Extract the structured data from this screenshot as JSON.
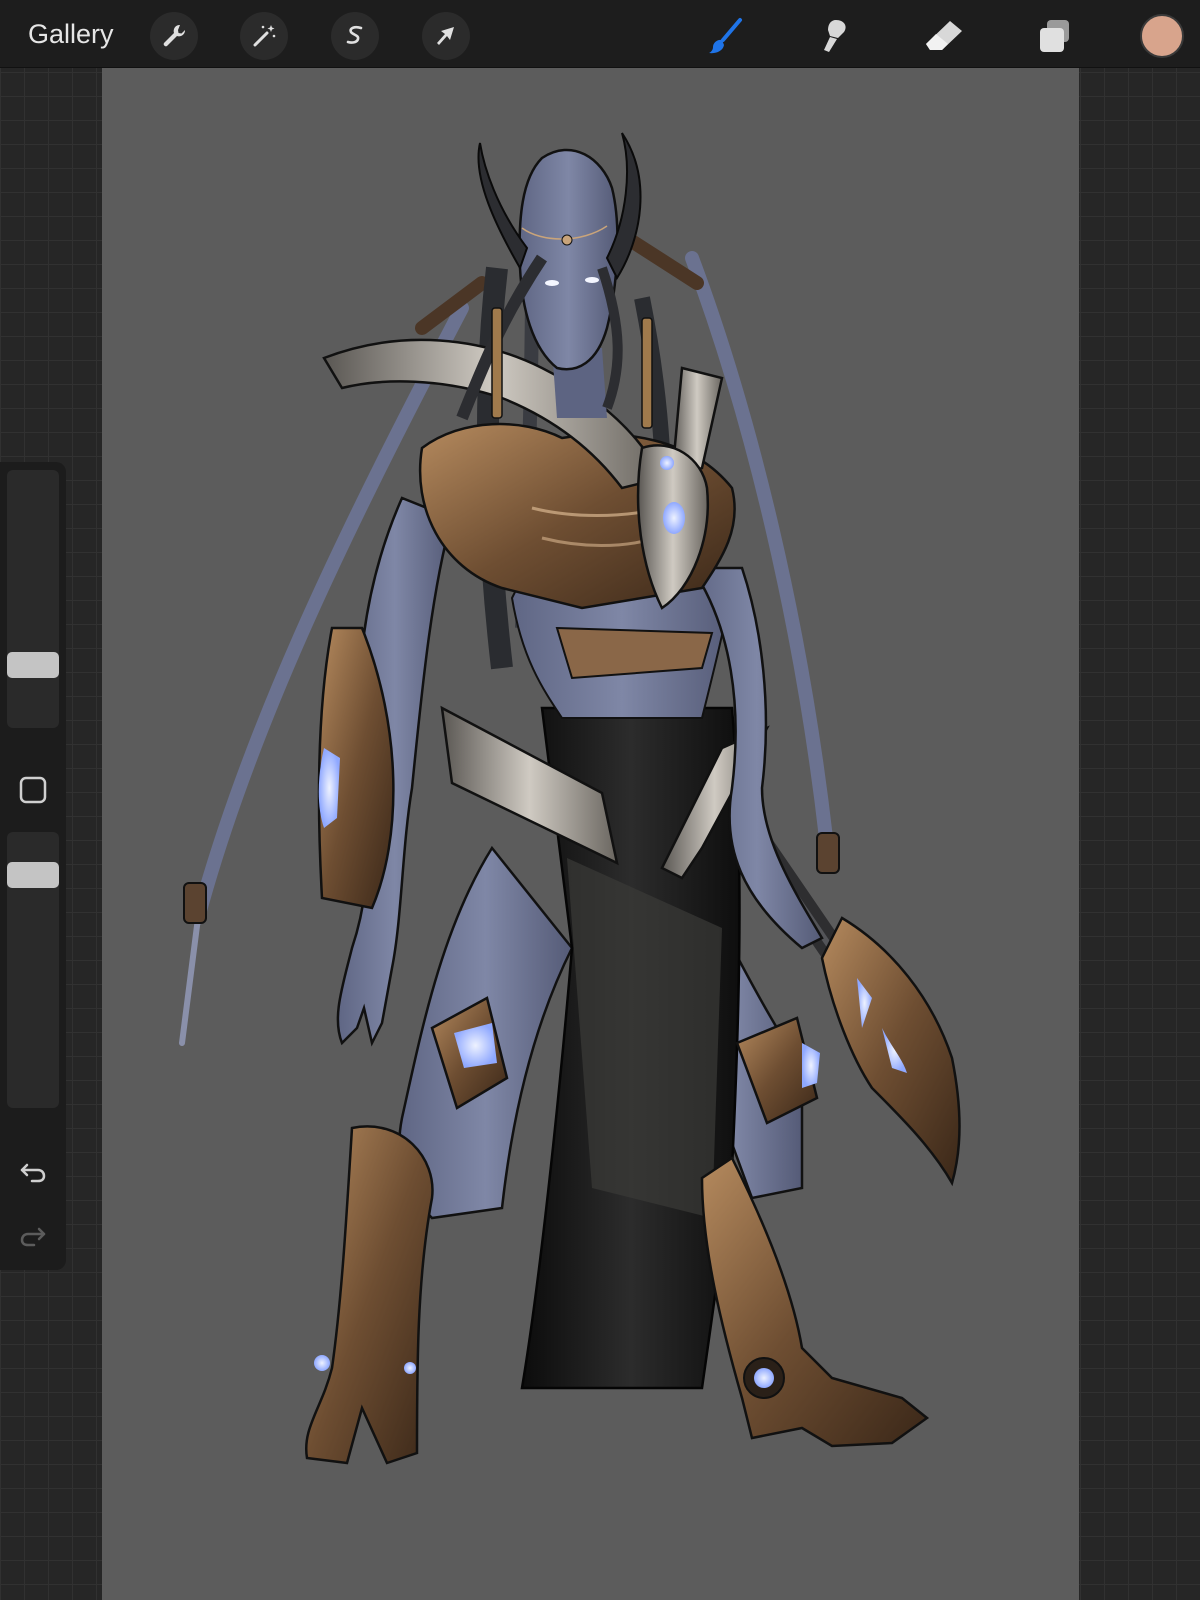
{
  "toolbar": {
    "gallery_label": "Gallery",
    "left_tools": [
      "wrench-icon",
      "magic-wand-icon",
      "selection-icon",
      "transform-arrow-icon"
    ],
    "right_tools": [
      "brush-icon",
      "smudge-icon",
      "eraser-icon",
      "layers-icon"
    ],
    "active_tool": "brush",
    "active_color": "#d8a48c",
    "accent_color": "#1f74e8"
  },
  "sidebar": {
    "brush_size": 0.25,
    "brush_opacity": 0.85
  },
  "colors": {
    "canvas": "#5c5c5c",
    "skin": "#717896",
    "armor_bronze": "#7a5a3c",
    "armor_steel": "#9a9690",
    "robe": "#141414",
    "glow": "#cfdcff"
  }
}
